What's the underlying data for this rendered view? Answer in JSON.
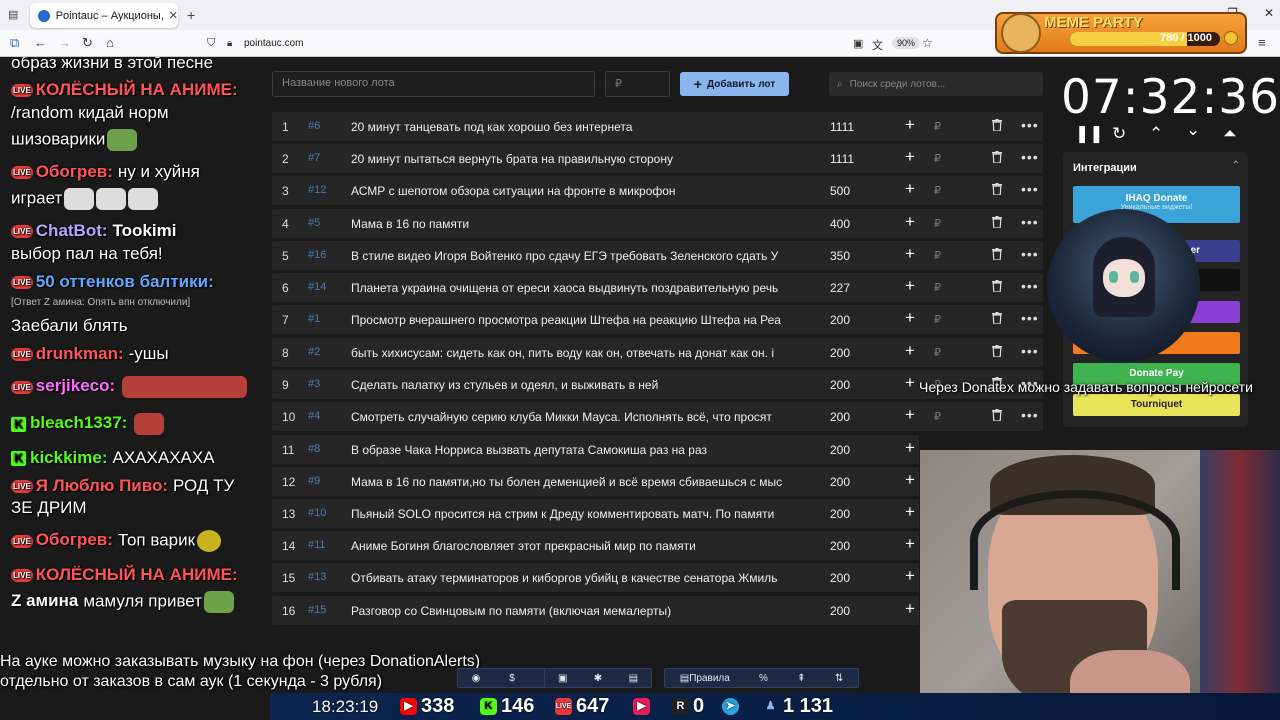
{
  "browser": {
    "tab_title": "Pointauc – Аукционы, лотереи",
    "url": "pointauc.com",
    "zoom": "90%"
  },
  "chat": [
    {
      "user": "",
      "msg": "образ жизни в этой песне",
      "top": 0
    },
    {
      "user": "КОЛЁСНЫЙ НА АНИМЕ:",
      "color": "#ff5555",
      "msg": "",
      "badge": "live"
    },
    {
      "msg": "/random кидай норм"
    },
    {
      "msg": "шизоварики"
    },
    {
      "user": "Обогрев:",
      "color": "#ff5555",
      "msg": "ну и хуйня",
      "badge": "live"
    },
    {
      "msg": "играет"
    },
    {
      "user": "ChatBot:",
      "color": "#b7a6ff",
      "msg": "Tookimi",
      "badge": "live"
    },
    {
      "msg": "выбор пал на тебя!"
    },
    {
      "user": "50 оттенков балтики:",
      "color": "#5fa8ff",
      "msg": "",
      "badge": "live"
    },
    {
      "reply": "[Ответ Z амина: Опять впн отключили]"
    },
    {
      "msg": "Заебали блять"
    },
    {
      "user": "drunkman:",
      "color": "#ff5555",
      "msg": "-ушы",
      "badge": "live"
    },
    {
      "user": "serjikeco:",
      "color": "#ff6bff",
      "msg": "",
      "badge": "live"
    },
    {
      "user": "bleach1337:",
      "color": "#53fc18",
      "msg": "",
      "badge": "kick"
    },
    {
      "user": "kickkime:",
      "color": "#53fc18",
      "msg": "АХАХАХАХА",
      "badge": "kick"
    },
    {
      "user": "Я Люблю Пиво:",
      "color": "#ff5555",
      "msg": "РОД ТУ",
      "badge": "live"
    },
    {
      "msg": "ЗЕ ДРИМ"
    },
    {
      "user": "Обогрев:",
      "color": "#ff5555",
      "msg": "Топ варик",
      "badge": "live"
    },
    {
      "user": "КОЛЁСНЫЙ НА АНИМЕ:",
      "color": "#ff5555",
      "msg": "",
      "badge": "live"
    },
    {
      "user": "Z амина",
      "color": "#ffffff",
      "msg": "мамуля привет"
    }
  ],
  "form": {
    "name_placeholder": "Название нового лота",
    "price_placeholder": "₽",
    "add_label": "Добавить лот",
    "search_placeholder": "Поиск среди лотов..."
  },
  "lots": [
    {
      "n": "1",
      "id": "#6",
      "name": "20 минут танцевать под как хорошо без интернета",
      "amount": "1111"
    },
    {
      "n": "2",
      "id": "#7",
      "name": "20 минут пытаться вернуть брата на правильную сторону",
      "amount": "1111"
    },
    {
      "n": "3",
      "id": "#12",
      "name": "АСМР с шепотом обзора ситуации на фронте в микрофон",
      "amount": "500"
    },
    {
      "n": "4",
      "id": "#5",
      "name": "Мама в 16 по памяти",
      "amount": "400"
    },
    {
      "n": "5",
      "id": "#16",
      "name": "В стиле видео Игоря Войтенко про сдачу ЕГЭ требовать Зеленского сдать У",
      "amount": "350"
    },
    {
      "n": "6",
      "id": "#14",
      "name": "Планета украина очищена от ереси хаоса выдвинуть поздравительную речь",
      "amount": "227"
    },
    {
      "n": "7",
      "id": "#1",
      "name": "Просмотр вчерашнего просмотра реакции Штефа на реакцию Штефа на Реа",
      "amount": "200"
    },
    {
      "n": "8",
      "id": "#2",
      "name": "быть хихисусам: сидеть как он, пить воду как он, отвечать на донат как он. i",
      "amount": "200"
    },
    {
      "n": "9",
      "id": "#3",
      "name": "Сделать палатку из стульев и одеял, и выживать в ней",
      "amount": "200"
    },
    {
      "n": "10",
      "id": "#4",
      "name": "Смотреть случайную серию клуба Микки Мауса. Исполнять всё, что просят",
      "amount": "200"
    },
    {
      "n": "11",
      "id": "#8",
      "name": "В образе Чака Норриса вызвать депутата Самокиша раз на раз",
      "amount": "200"
    },
    {
      "n": "12",
      "id": "#9",
      "name": "Мама в 16 по памяти,но ты болен деменцией и всё время сбиваешься с мыс",
      "amount": "200"
    },
    {
      "n": "13",
      "id": "#10",
      "name": "Пьяный SOLO просится на стрим к Дреду комментировать матч. По памяти",
      "amount": "200"
    },
    {
      "n": "14",
      "id": "#11",
      "name": "Аниме Богиня благословляет этот прекрасный мир по памяти",
      "amount": "200"
    },
    {
      "n": "15",
      "id": "#13",
      "name": "Отбивать атаку терминаторов и киборгов убийц в качестве сенатора Жмиль",
      "amount": "200"
    },
    {
      "n": "16",
      "id": "#15",
      "name": "Разговор со Свинцовым по памяти (включая мемалерты)",
      "amount": "200"
    }
  ],
  "timer": "07:32:36",
  "integrations": {
    "title": "Интеграции",
    "ihaq": "IHAQ Donate",
    "ihaq_sub": "Уникальные виджеты!",
    "da_tail": "er",
    "alerts_tail": "alerts",
    "donatepay": "Donate Pay",
    "tourniquet": "Tourniquet"
  },
  "overlay": {
    "donatex": "Через Donatex можно задавать вопросы нейросети",
    "line1": "На ауке можно заказывать музыку на фон (через DonationAlerts)",
    "line2": "отдельно от заказов в сам аук (1 секунда - 3 рубля)",
    "rules": "Правила",
    "pct": "%"
  },
  "stats": {
    "clock": "18:23:19",
    "youtube": "338",
    "kick": "146",
    "live": "647",
    "r": "0",
    "users": "1 131"
  },
  "meme": {
    "title": "MEME PARTY",
    "progress": "780 / 1000",
    "fraction": 0.78
  },
  "colors": {
    "accent": "#8ab6ee",
    "row": "#262626",
    "bg": "#1a1a1a"
  }
}
